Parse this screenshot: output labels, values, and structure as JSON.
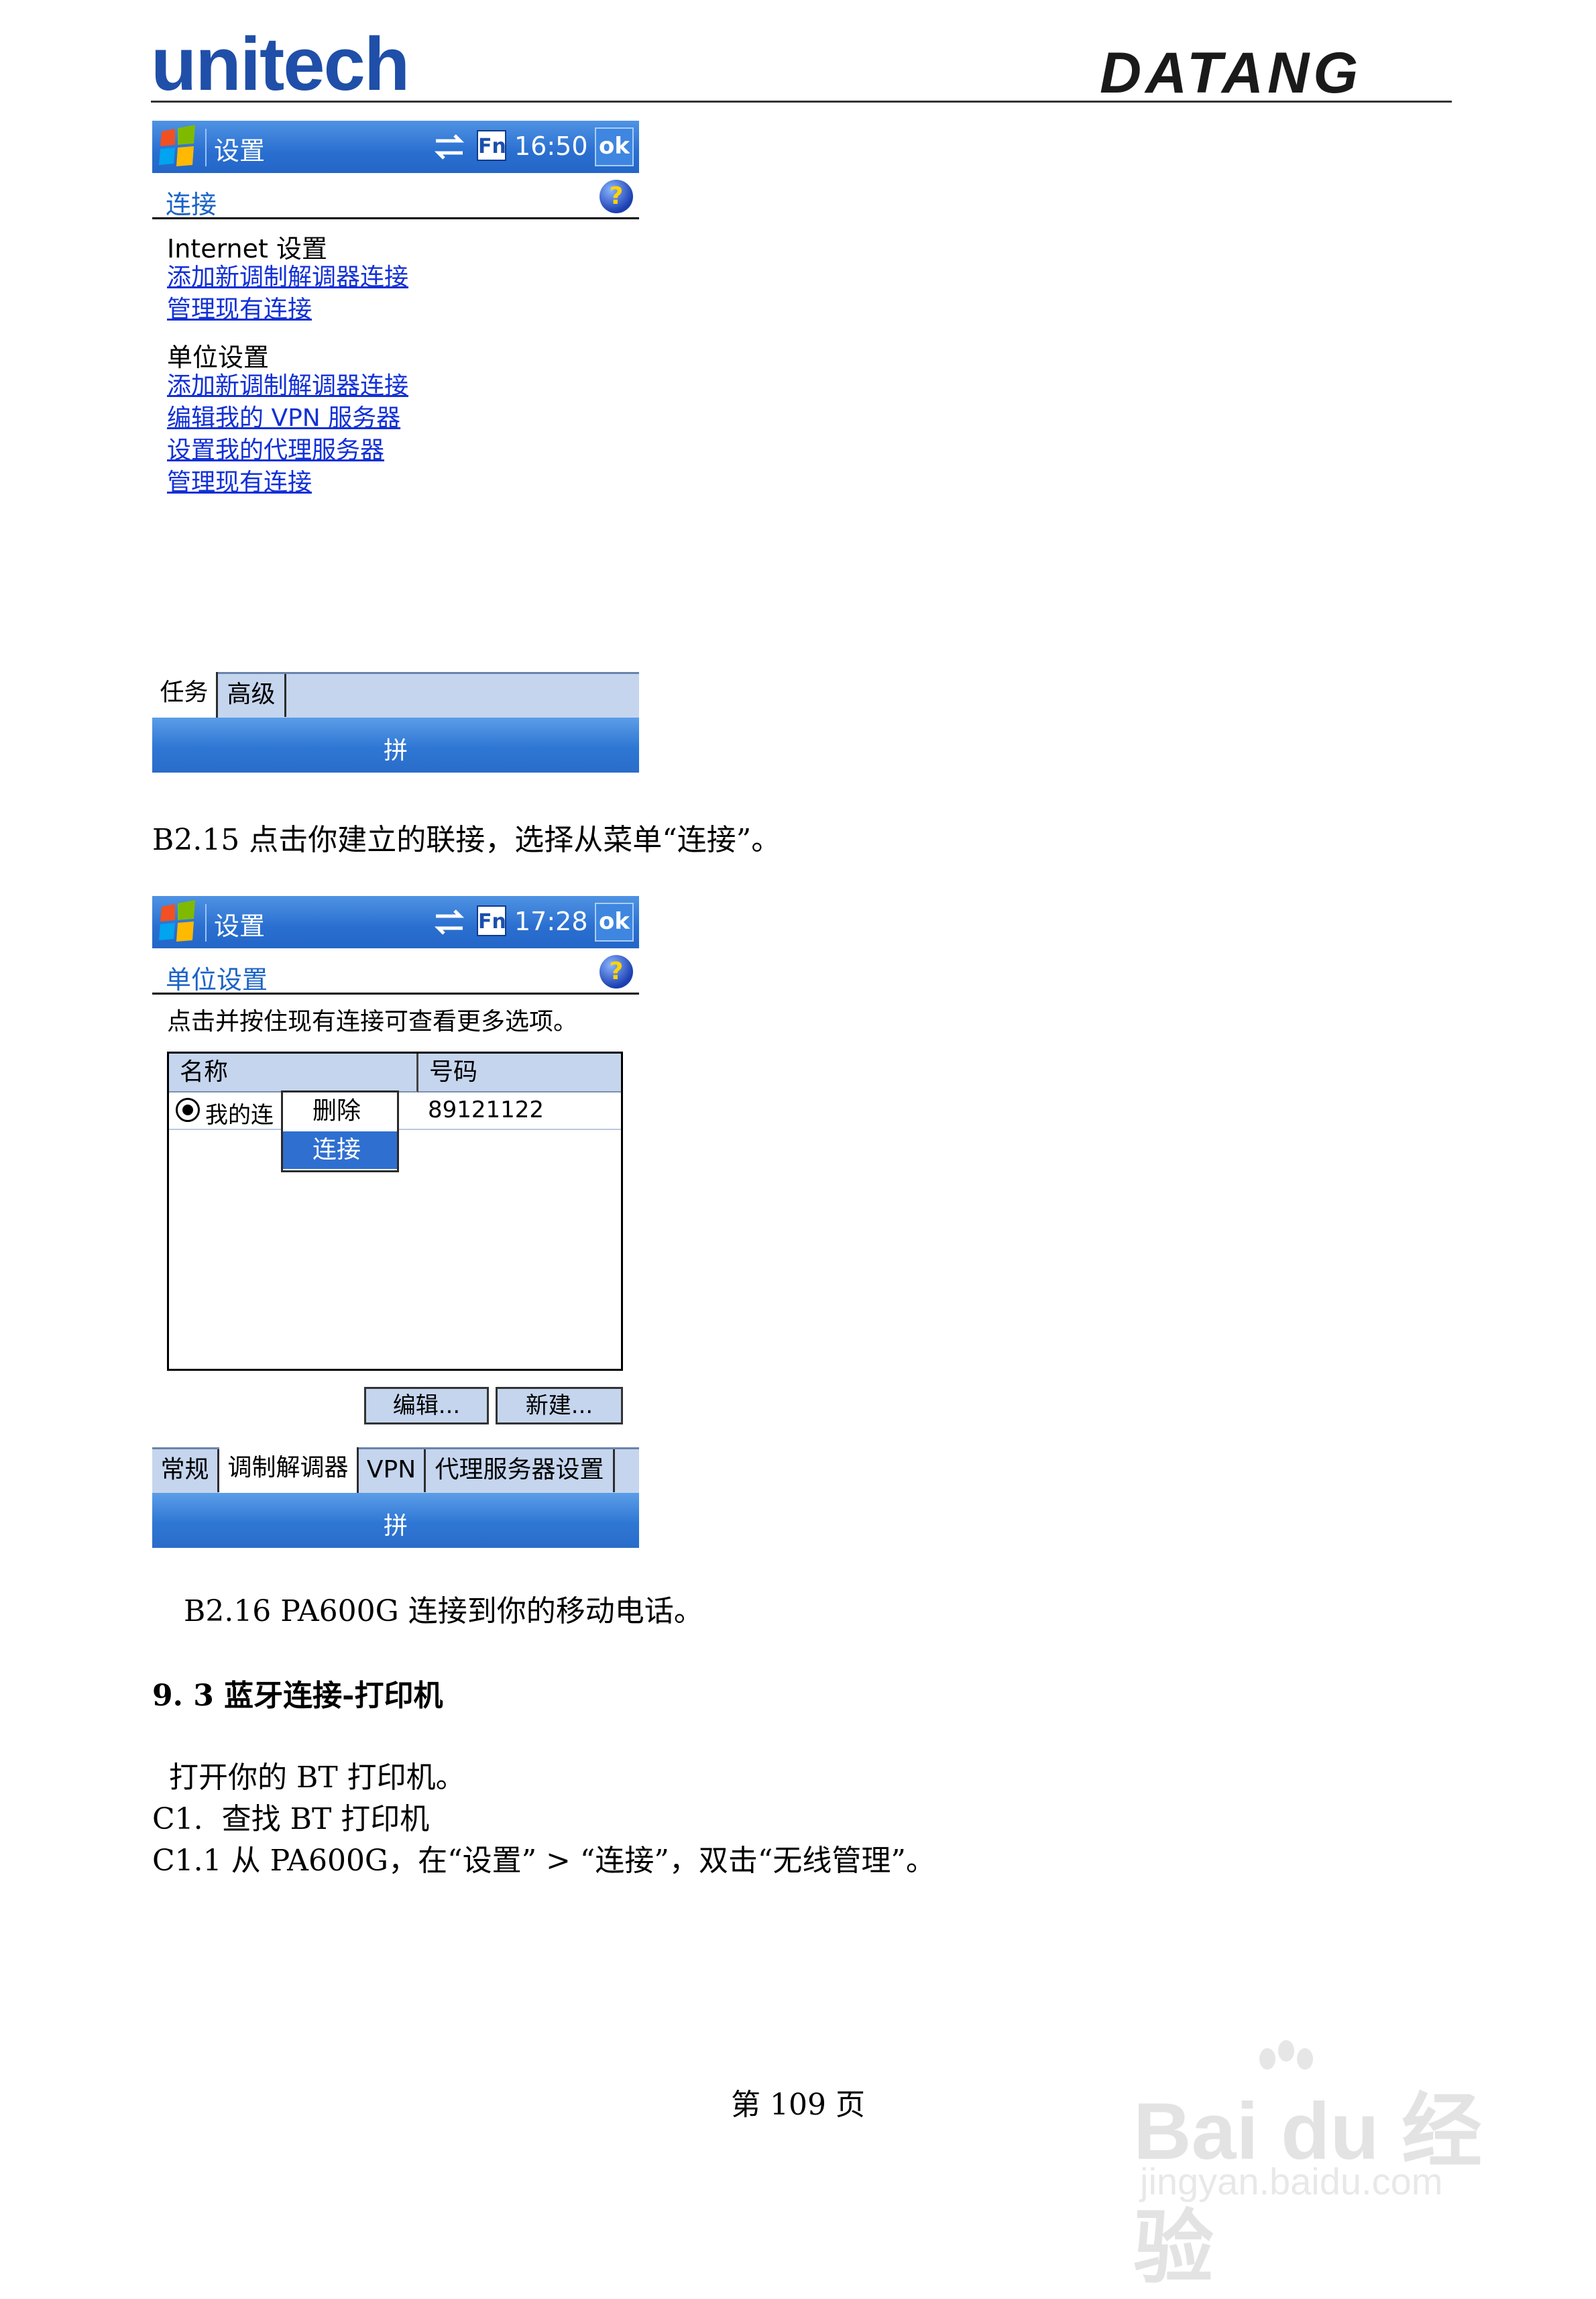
{
  "header": {
    "left_logo": "unitech",
    "right_logo": "DATANG"
  },
  "screen1": {
    "window_title": "设置",
    "time": "16:50",
    "ok_label": "ok",
    "fn_label": "Fn",
    "subtitle": "连接",
    "internet_section": "Internet 设置",
    "internet_links": [
      "添加新调制解调器连接",
      "管理现有连接"
    ],
    "work_section": "单位设置",
    "work_links": [
      "添加新调制解调器连接",
      "编辑我的 VPN 服务器",
      "设置我的代理服务器",
      "管理现有连接"
    ],
    "tabs": [
      "任务",
      "高级"
    ],
    "menubar_label": "拼"
  },
  "caption1": "B2.15 点击你建立的联接，选择从菜单“连接”。",
  "screen2": {
    "window_title": "设置",
    "time": "17:28",
    "ok_label": "ok",
    "fn_label": "Fn",
    "subtitle": "单位设置",
    "instruction": "点击并按住现有连接可查看更多选项。",
    "columns": [
      "名称",
      "号码"
    ],
    "row": {
      "name": "我的连",
      "number": "89121122"
    },
    "context_menu": [
      "删除",
      "连接"
    ],
    "buttons": [
      "编辑...",
      "新建..."
    ],
    "tabs": [
      "常规",
      "调制解调器",
      "VPN",
      "代理服务器设置"
    ],
    "menubar_label": "拼"
  },
  "caption2": "B2.16 PA600G 连接到你的移动电话。",
  "section_heading": "9. 3 蓝牙连接-打印机",
  "paragraphs": [
    "打开你的 BT 打印机。",
    "C1.  查找 BT 打印机",
    "C1.1 从 PA600G，在“设置” > “连接”，双击“无线管理”。"
  ],
  "page_number": "第 109 页",
  "watermark": {
    "main": "Bai du 经验",
    "sub": "jingyan.baidu.com"
  },
  "colors": {
    "title_bar": "#2a6fd0",
    "link": "#1230d6",
    "tab_bg": "#c5d5ee",
    "brand_blue": "#1f4fa8"
  }
}
